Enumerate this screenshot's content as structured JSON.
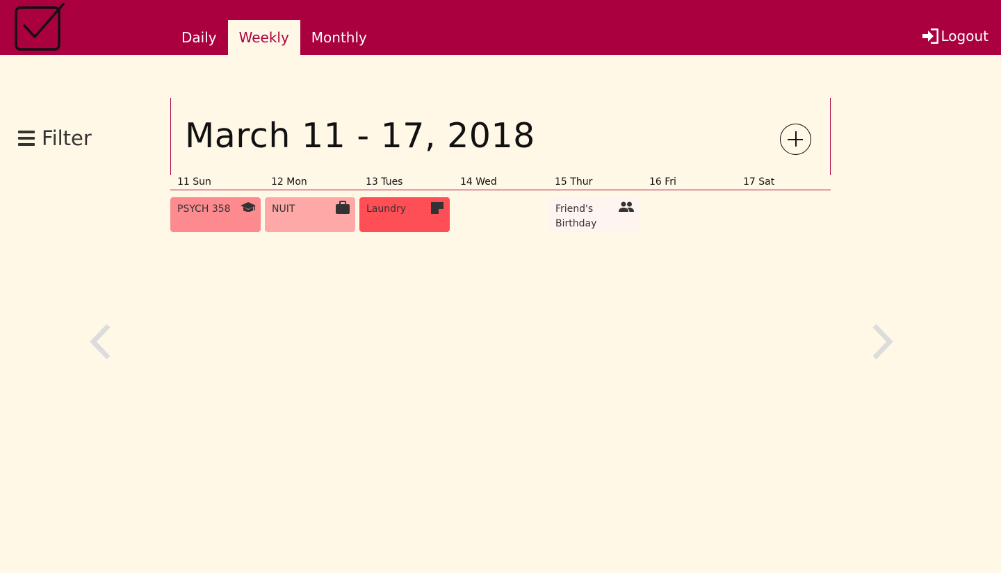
{
  "header": {
    "tabs": [
      {
        "label": "Daily",
        "active": false
      },
      {
        "label": "Weekly",
        "active": true
      },
      {
        "label": "Monthly",
        "active": false
      }
    ],
    "logout_label": "Logout",
    "brand_color": "#ab0040"
  },
  "sidebar": {
    "filter_label": "Filter"
  },
  "week": {
    "title": "March 11 - 17, 2018",
    "days": [
      "11 Sun",
      "12 Mon",
      "13 Tues",
      "14 Wed",
      "15 Thur",
      "16 Fri",
      "17 Sat"
    ]
  },
  "events": [
    {
      "label": "PSYCH 358",
      "day": "11 Sun",
      "icon": "graduation-cap-icon",
      "color": "#fd8a8e"
    },
    {
      "label": "NUIT",
      "day": "12 Mon",
      "icon": "briefcase-icon",
      "color": "#fea8a8"
    },
    {
      "label": "Laundry",
      "day": "13 Tues",
      "icon": "note-icon",
      "color": "#fe4f57"
    },
    {
      "label": "Friend's Birthday",
      "day": "15 Thur",
      "icon": "people-icon",
      "color": "#fef5f0"
    }
  ]
}
